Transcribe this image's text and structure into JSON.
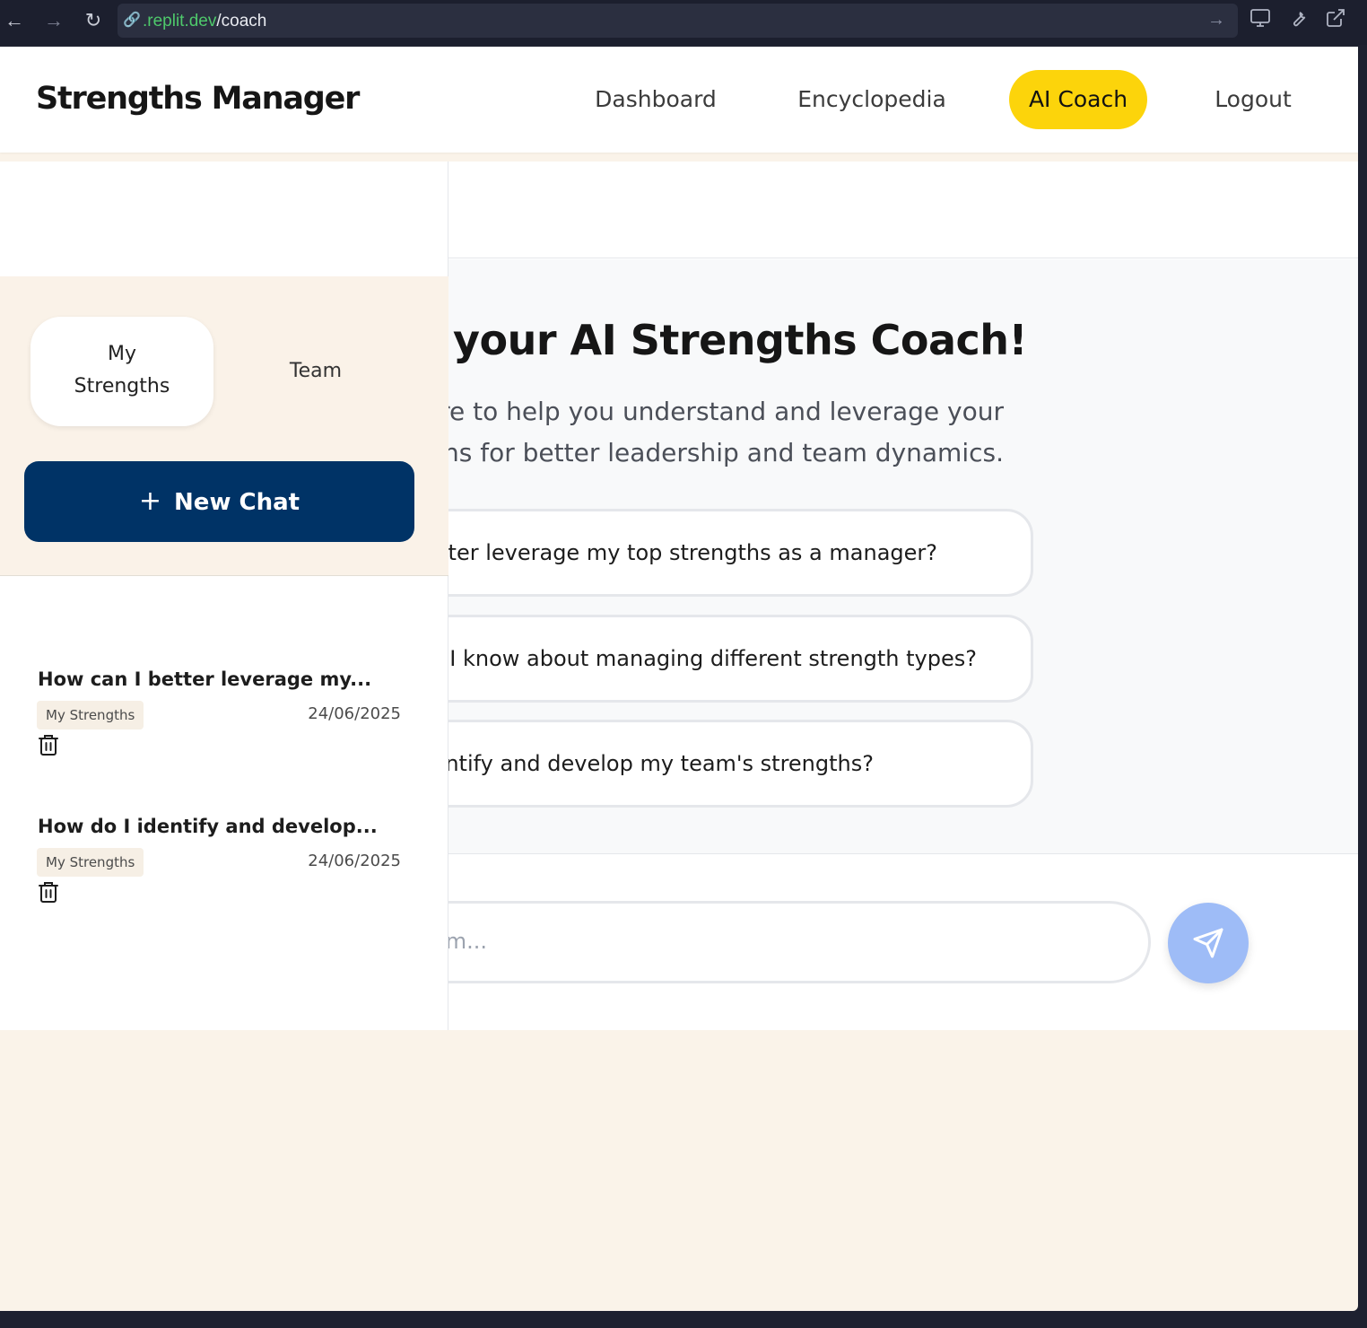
{
  "browser": {
    "url_host": ".replit.dev",
    "url_path": "/coach"
  },
  "header": {
    "brand": "Strengths Manager",
    "nav": [
      {
        "label": "Dashboard",
        "active": false
      },
      {
        "label": "Encyclopedia",
        "active": false
      },
      {
        "label": "AI Coach",
        "active": true
      },
      {
        "label": "Logout",
        "active": false
      }
    ]
  },
  "sidebar": {
    "tabs": [
      {
        "label": "My Strengths",
        "active": true
      },
      {
        "label": "Team",
        "active": false
      }
    ],
    "new_chat_label": "New Chat",
    "chats": [
      {
        "title": "How can I better leverage my...",
        "tag": "My Strengths",
        "date": "24/06/2025"
      },
      {
        "title": "How do I identify and develop...",
        "tag": "My Strengths",
        "date": "24/06/2025"
      }
    ]
  },
  "chat": {
    "welcome_title": "me to your AI Strengths Coach!",
    "welcome_sub_line1": "ere to help you understand and leverage your",
    "welcome_sub_line2": "rengths for better leadership and team dynamics.",
    "suggestions": [
      " better leverage my top strengths as a manager?",
      "uld I know about managing different strength types?",
      "dentify and develop my team's strengths?"
    ],
    "input_placeholder": "m..."
  },
  "colors": {
    "accent_yellow": "#fcd40b",
    "primary_navy": "#003366",
    "page_bg": "#faf3e9",
    "send_button": "#9ebcf7"
  }
}
